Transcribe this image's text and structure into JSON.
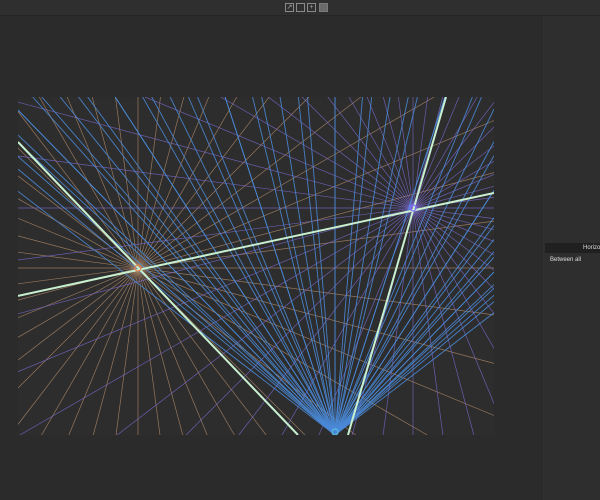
{
  "toolbar": {
    "buttons": [
      {
        "icon": "external-link-icon"
      },
      {
        "icon": "frame-icon"
      },
      {
        "icon": "fit-icon"
      },
      {
        "icon": "grid-icon",
        "active": true
      }
    ]
  },
  "panel": {
    "header": "Horizon",
    "option": "Between all"
  },
  "colors": {
    "background": "#2b2b2b",
    "horizon": "#c8f0d0",
    "vp1_lines": "#b08a6a",
    "vp2_lines": "#7a6ad0",
    "vp3_lines": "#4a8ad8"
  }
}
